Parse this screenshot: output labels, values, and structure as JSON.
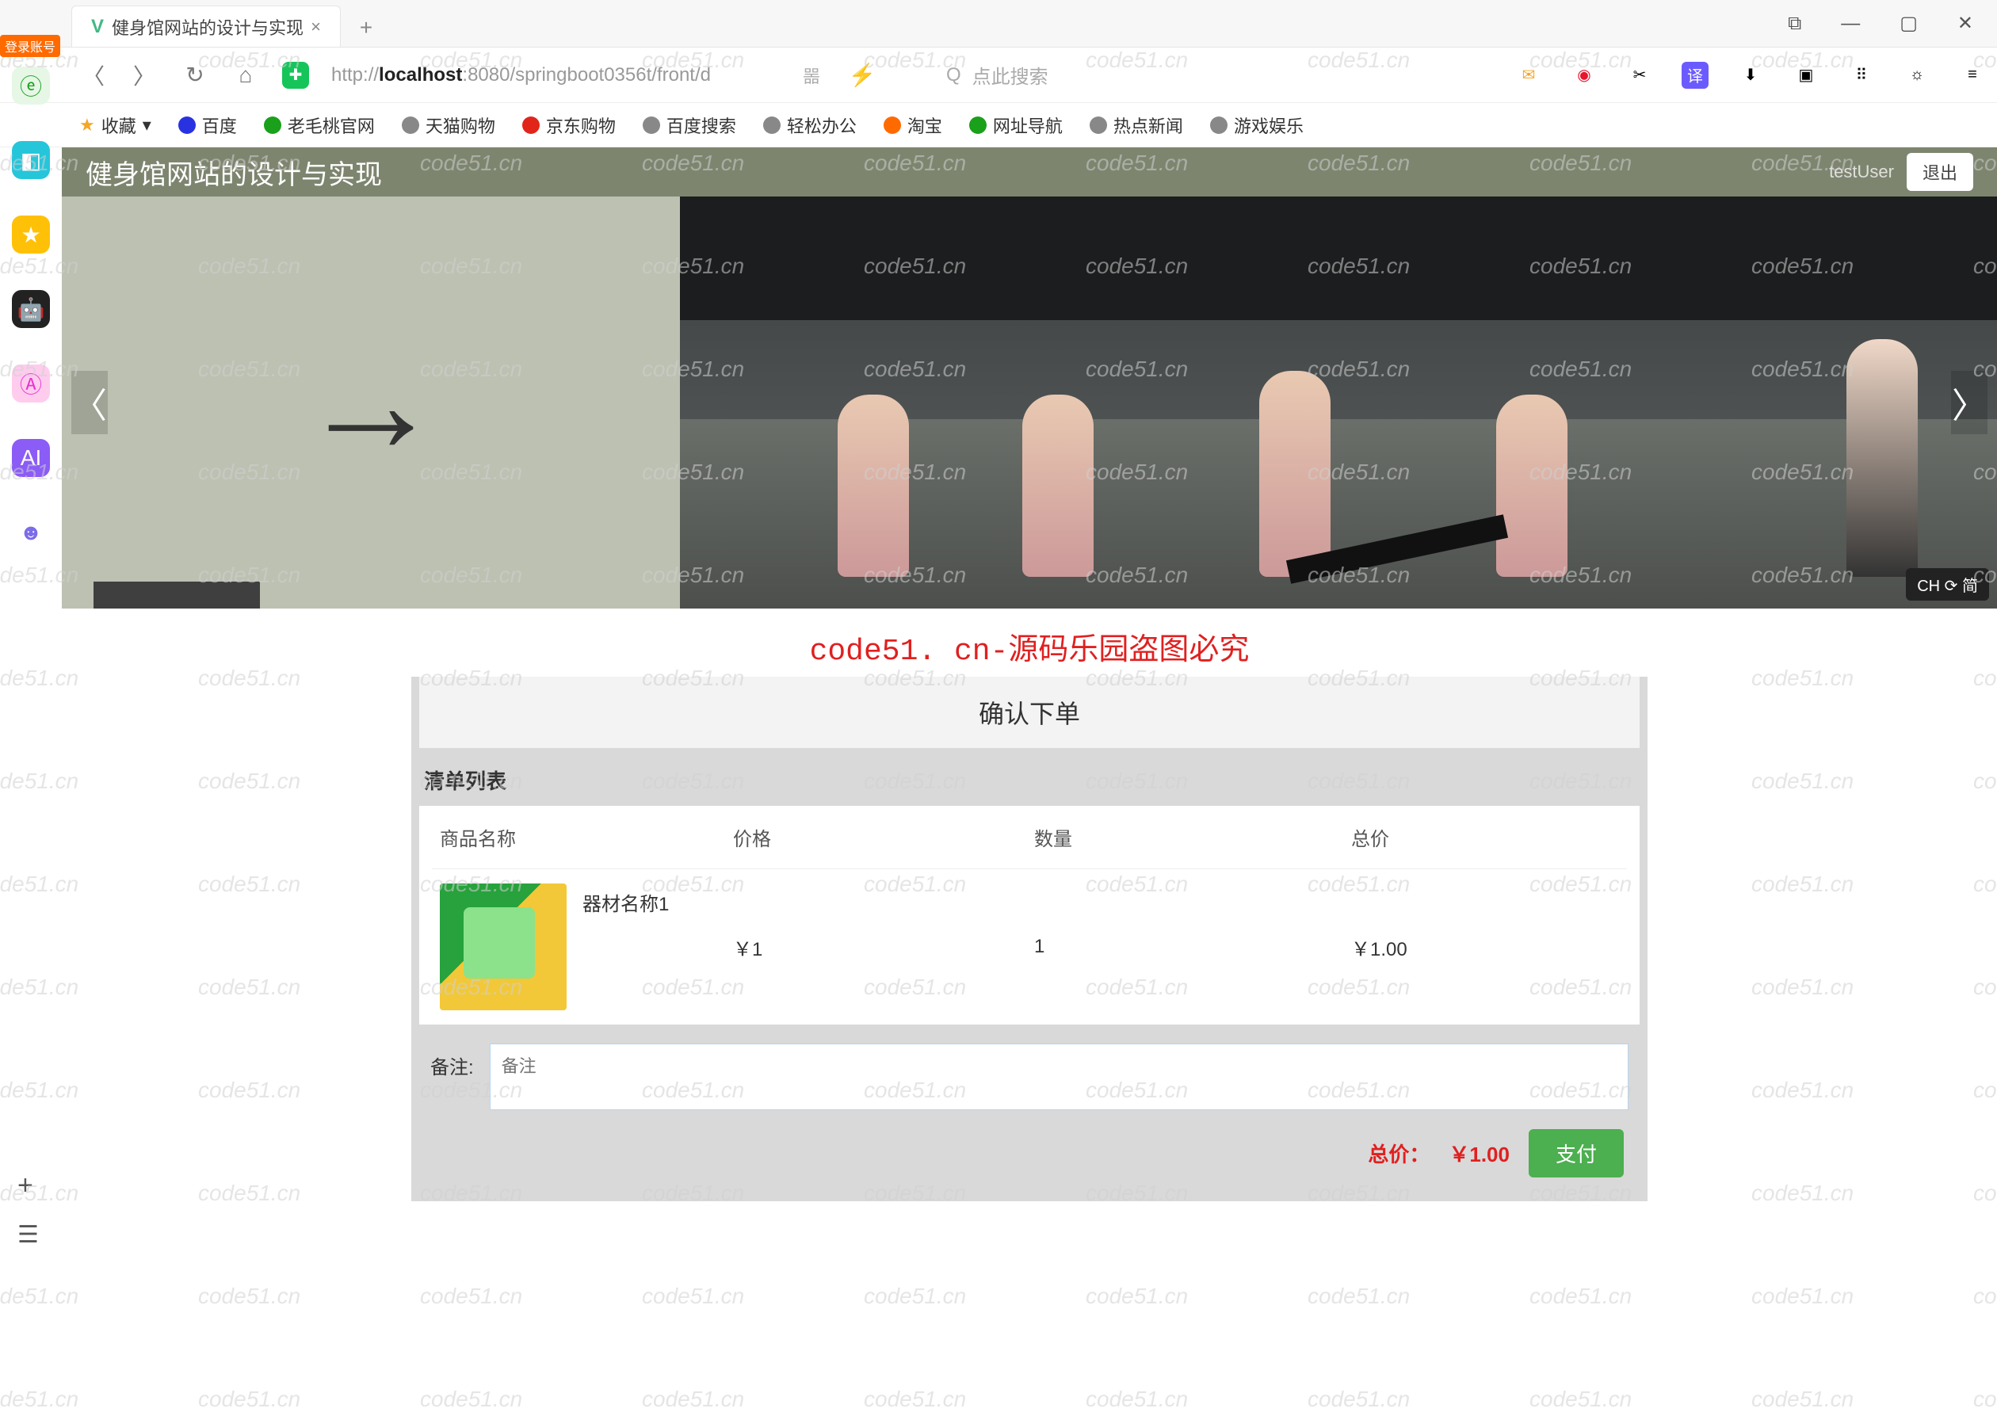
{
  "browser": {
    "tab_title": "健身馆网站的设计与实现",
    "url_prefix": "http://",
    "url_host": "localhost",
    "url_port_path": ":8080/springboot0356t/front/d",
    "search_placeholder": "点此搜索",
    "login_tag": "登录账号",
    "window": {
      "box": "⧉",
      "min": "—",
      "max": "▢",
      "close": "✕"
    },
    "ime": "CH ⟳ 简"
  },
  "bookmarks": {
    "fav": "收藏",
    "items": [
      "百度",
      "老毛桃官网",
      "天猫购物",
      "京东购物",
      "百度搜索",
      "轻松办公",
      "淘宝",
      "网址导航",
      "热点新闻",
      "游戏娱乐"
    ]
  },
  "header": {
    "site_title": "健身馆网站的设计与实现",
    "user": "testUser",
    "logout": "退出"
  },
  "watermark_red": "code51. cn-源码乐园盗图必究",
  "watermark_grey": "code51.cn",
  "order": {
    "confirm_title": "确认下单",
    "list_title": "清单列表",
    "columns": {
      "name": "商品名称",
      "price": "价格",
      "qty": "数量",
      "subtotal": "总价"
    },
    "items": [
      {
        "name": "器材名称1",
        "price": "￥1",
        "qty": "1",
        "subtotal": "￥1.00"
      }
    ],
    "remark_label": "备注:",
    "remark_placeholder": "备注",
    "total_label": "总价：",
    "total_value": "￥1.00",
    "pay_label": "支付"
  }
}
